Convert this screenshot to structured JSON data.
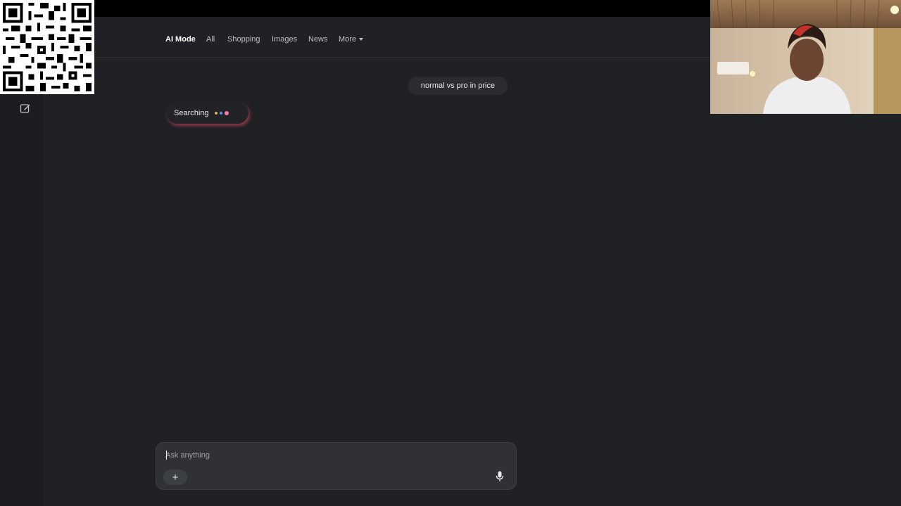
{
  "nav": {
    "items": [
      {
        "label": "AI Mode",
        "active": true
      },
      {
        "label": "All",
        "active": false
      },
      {
        "label": "Shopping",
        "active": false
      },
      {
        "label": "Images",
        "active": false
      },
      {
        "label": "News",
        "active": false
      },
      {
        "label": "More",
        "active": false,
        "has_dropdown": true
      }
    ]
  },
  "sidebar": {
    "compose_icon": "new-chat-icon"
  },
  "chat": {
    "user_query": "normal vs pro in price",
    "status_text": "Searching",
    "status_sparkle_colors": [
      "#e8b04a",
      "#5b8ff0",
      "#ff7aa8"
    ]
  },
  "composer": {
    "placeholder": "Ask anything",
    "value": "",
    "add_icon": "plus-icon",
    "mic_icon": "microphone-icon"
  },
  "overlays": {
    "qr_code": "qr-code-image",
    "webcam": "webcam-feed"
  },
  "colors": {
    "background": "#202124",
    "nav_active": "#ffffff",
    "nav_inactive": "#bdc1c6",
    "bubble": "#2b2c2f",
    "composer": "#303134",
    "searching_glow": "#e8486e"
  }
}
